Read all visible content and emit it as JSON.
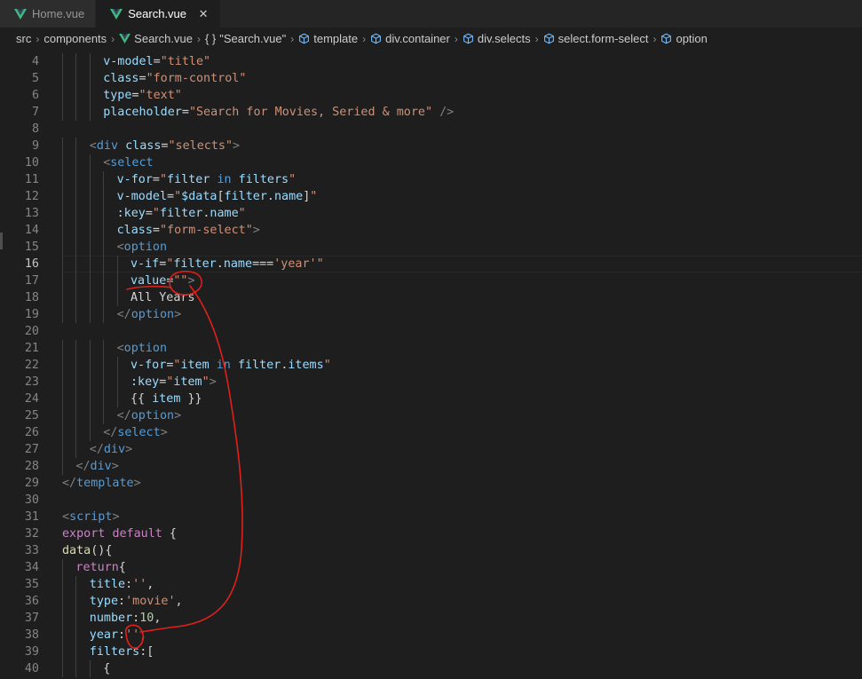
{
  "tabs": [
    {
      "label": "Home.vue",
      "active": false
    },
    {
      "label": "Search.vue",
      "active": true,
      "close": "✕"
    }
  ],
  "breadcrumb": {
    "parts": [
      "src",
      "components",
      "Search.vue",
      "\"Search.vue\"",
      "template",
      "div.container",
      "div.selects",
      "select.form-select",
      "option"
    ],
    "brace": "{ }"
  },
  "colors": {
    "accent_vue_green": "#41b883",
    "annotation_red": "#e0201c",
    "bg": "#1e1e1e"
  },
  "editor": {
    "current_line": 16,
    "lines": [
      {
        "n": "4",
        "indent": 3,
        "tokens": [
          [
            "t-attr",
            "v-model"
          ],
          [
            "t-txt",
            "="
          ],
          [
            "t-str",
            "\"title\""
          ]
        ]
      },
      {
        "n": "5",
        "indent": 3,
        "tokens": [
          [
            "t-attr",
            "class"
          ],
          [
            "t-txt",
            "="
          ],
          [
            "t-str",
            "\"form-control\""
          ]
        ]
      },
      {
        "n": "6",
        "indent": 3,
        "tokens": [
          [
            "t-attr",
            "type"
          ],
          [
            "t-txt",
            "="
          ],
          [
            "t-str",
            "\"text\""
          ]
        ]
      },
      {
        "n": "7",
        "indent": 3,
        "tokens": [
          [
            "t-attr",
            "placeholder"
          ],
          [
            "t-txt",
            "="
          ],
          [
            "t-str",
            "\"Search for Movies, Seried & more\""
          ],
          [
            "t-txt",
            " "
          ],
          [
            "t-br",
            "/>"
          ]
        ]
      },
      {
        "n": "8",
        "indent": 0,
        "tokens": []
      },
      {
        "n": "9",
        "indent": 2,
        "tokens": [
          [
            "t-br",
            "<"
          ],
          [
            "t-tag",
            "div"
          ],
          [
            "t-txt",
            " "
          ],
          [
            "t-attr",
            "class"
          ],
          [
            "t-txt",
            "="
          ],
          [
            "t-str",
            "\"selects\""
          ],
          [
            "t-br",
            ">"
          ]
        ]
      },
      {
        "n": "10",
        "indent": 3,
        "tokens": [
          [
            "t-br",
            "<"
          ],
          [
            "t-tag",
            "select"
          ]
        ]
      },
      {
        "n": "11",
        "indent": 4,
        "tokens": [
          [
            "t-attr",
            "v-for"
          ],
          [
            "t-txt",
            "="
          ],
          [
            "t-str",
            "\""
          ],
          [
            "t-attr",
            "filter"
          ],
          [
            "t-txt",
            " "
          ],
          [
            "t-kw",
            "in"
          ],
          [
            "t-txt",
            " "
          ],
          [
            "t-attr",
            "filters"
          ],
          [
            "t-str",
            "\""
          ]
        ]
      },
      {
        "n": "12",
        "indent": 4,
        "tokens": [
          [
            "t-attr",
            "v-model"
          ],
          [
            "t-txt",
            "="
          ],
          [
            "t-str",
            "\""
          ],
          [
            "t-attr",
            "$data"
          ],
          [
            "t-txt",
            "["
          ],
          [
            "t-attr",
            "filter"
          ],
          [
            "t-txt",
            "."
          ],
          [
            "t-attr",
            "name"
          ],
          [
            "t-txt",
            "]"
          ],
          [
            "t-str",
            "\""
          ]
        ]
      },
      {
        "n": "13",
        "indent": 4,
        "tokens": [
          [
            "t-attr",
            ":key"
          ],
          [
            "t-txt",
            "="
          ],
          [
            "t-str",
            "\""
          ],
          [
            "t-attr",
            "filter"
          ],
          [
            "t-txt",
            "."
          ],
          [
            "t-attr",
            "name"
          ],
          [
            "t-str",
            "\""
          ]
        ]
      },
      {
        "n": "14",
        "indent": 4,
        "tokens": [
          [
            "t-attr",
            "class"
          ],
          [
            "t-txt",
            "="
          ],
          [
            "t-str",
            "\"form-select\""
          ],
          [
            "t-br",
            ">"
          ]
        ]
      },
      {
        "n": "15",
        "indent": 4,
        "tokens": [
          [
            "t-br",
            "<"
          ],
          [
            "t-tag",
            "option"
          ]
        ]
      },
      {
        "n": "16",
        "indent": 5,
        "tokens": [
          [
            "t-attr",
            "v-if"
          ],
          [
            "t-txt",
            "="
          ],
          [
            "t-str",
            "\""
          ],
          [
            "t-attr",
            "filter"
          ],
          [
            "t-txt",
            "."
          ],
          [
            "t-attr",
            "name"
          ],
          [
            "t-txt",
            "==="
          ],
          [
            "t-str",
            "'year'"
          ],
          [
            "t-str",
            "\""
          ]
        ]
      },
      {
        "n": "17",
        "indent": 5,
        "tokens": [
          [
            "t-attr",
            "value"
          ],
          [
            "t-txt",
            "="
          ],
          [
            "t-str",
            "\"\""
          ],
          [
            "t-br",
            ">"
          ]
        ]
      },
      {
        "n": "18",
        "indent": 5,
        "tokens": [
          [
            "t-txt",
            "All Years"
          ]
        ]
      },
      {
        "n": "19",
        "indent": 4,
        "tokens": [
          [
            "t-br",
            "</"
          ],
          [
            "t-tag",
            "option"
          ],
          [
            "t-br",
            ">"
          ]
        ]
      },
      {
        "n": "20",
        "indent": 0,
        "tokens": []
      },
      {
        "n": "21",
        "indent": 4,
        "tokens": [
          [
            "t-br",
            "<"
          ],
          [
            "t-tag",
            "option"
          ]
        ]
      },
      {
        "n": "22",
        "indent": 5,
        "tokens": [
          [
            "t-attr",
            "v-for"
          ],
          [
            "t-txt",
            "="
          ],
          [
            "t-str",
            "\""
          ],
          [
            "t-attr",
            "item"
          ],
          [
            "t-txt",
            " "
          ],
          [
            "t-kw",
            "in"
          ],
          [
            "t-txt",
            " "
          ],
          [
            "t-attr",
            "filter"
          ],
          [
            "t-txt",
            "."
          ],
          [
            "t-attr",
            "items"
          ],
          [
            "t-str",
            "\""
          ]
        ]
      },
      {
        "n": "23",
        "indent": 5,
        "tokens": [
          [
            "t-attr",
            ":key"
          ],
          [
            "t-txt",
            "="
          ],
          [
            "t-str",
            "\""
          ],
          [
            "t-attr",
            "item"
          ],
          [
            "t-str",
            "\""
          ],
          [
            "t-br",
            ">"
          ]
        ]
      },
      {
        "n": "24",
        "indent": 5,
        "tokens": [
          [
            "t-txt",
            "{{ "
          ],
          [
            "t-attr",
            "item"
          ],
          [
            "t-txt",
            " }}"
          ]
        ]
      },
      {
        "n": "25",
        "indent": 4,
        "tokens": [
          [
            "t-br",
            "</"
          ],
          [
            "t-tag",
            "option"
          ],
          [
            "t-br",
            ">"
          ]
        ]
      },
      {
        "n": "26",
        "indent": 3,
        "tokens": [
          [
            "t-br",
            "</"
          ],
          [
            "t-tag",
            "select"
          ],
          [
            "t-br",
            ">"
          ]
        ]
      },
      {
        "n": "27",
        "indent": 2,
        "tokens": [
          [
            "t-br",
            "</"
          ],
          [
            "t-tag",
            "div"
          ],
          [
            "t-br",
            ">"
          ]
        ]
      },
      {
        "n": "28",
        "indent": 1,
        "tokens": [
          [
            "t-br",
            "</"
          ],
          [
            "t-tag",
            "div"
          ],
          [
            "t-br",
            ">"
          ]
        ]
      },
      {
        "n": "29",
        "indent": 0,
        "tokens": [
          [
            "t-br",
            "</"
          ],
          [
            "t-tag",
            "template"
          ],
          [
            "t-br",
            ">"
          ]
        ]
      },
      {
        "n": "30",
        "indent": 0,
        "tokens": []
      },
      {
        "n": "31",
        "indent": 0,
        "tokens": [
          [
            "t-br",
            "<"
          ],
          [
            "t-tag",
            "script"
          ],
          [
            "t-br",
            ">"
          ]
        ]
      },
      {
        "n": "32",
        "indent": 0,
        "tokens": [
          [
            "t-ctl",
            "export"
          ],
          [
            "t-txt",
            " "
          ],
          [
            "t-ctl",
            "default"
          ],
          [
            "t-txt",
            " {"
          ]
        ]
      },
      {
        "n": "33",
        "indent": 0,
        "tokens": [
          [
            "t-fn",
            "data"
          ],
          [
            "t-txt",
            "(){"
          ]
        ]
      },
      {
        "n": "34",
        "indent": 1,
        "tokens": [
          [
            "t-ctl",
            "return"
          ],
          [
            "t-txt",
            "{"
          ]
        ]
      },
      {
        "n": "35",
        "indent": 2,
        "tokens": [
          [
            "t-attr",
            "title"
          ],
          [
            "t-txt",
            ":"
          ],
          [
            "t-str",
            "''"
          ],
          [
            "t-txt",
            ","
          ]
        ]
      },
      {
        "n": "36",
        "indent": 2,
        "tokens": [
          [
            "t-attr",
            "type"
          ],
          [
            "t-txt",
            ":"
          ],
          [
            "t-str",
            "'movie'"
          ],
          [
            "t-txt",
            ","
          ]
        ]
      },
      {
        "n": "37",
        "indent": 2,
        "tokens": [
          [
            "t-attr",
            "number"
          ],
          [
            "t-txt",
            ":"
          ],
          [
            "t-num",
            "10"
          ],
          [
            "t-txt",
            ","
          ]
        ]
      },
      {
        "n": "38",
        "indent": 2,
        "tokens": [
          [
            "t-attr",
            "year"
          ],
          [
            "t-txt",
            ":"
          ],
          [
            "t-str",
            "''"
          ],
          [
            "t-txt",
            ","
          ]
        ]
      },
      {
        "n": "39",
        "indent": 2,
        "tokens": [
          [
            "t-attr",
            "filters"
          ],
          [
            "t-txt",
            ":["
          ]
        ]
      },
      {
        "n": "40",
        "indent": 3,
        "tokens": [
          [
            "t-txt",
            "{"
          ]
        ]
      }
    ]
  }
}
